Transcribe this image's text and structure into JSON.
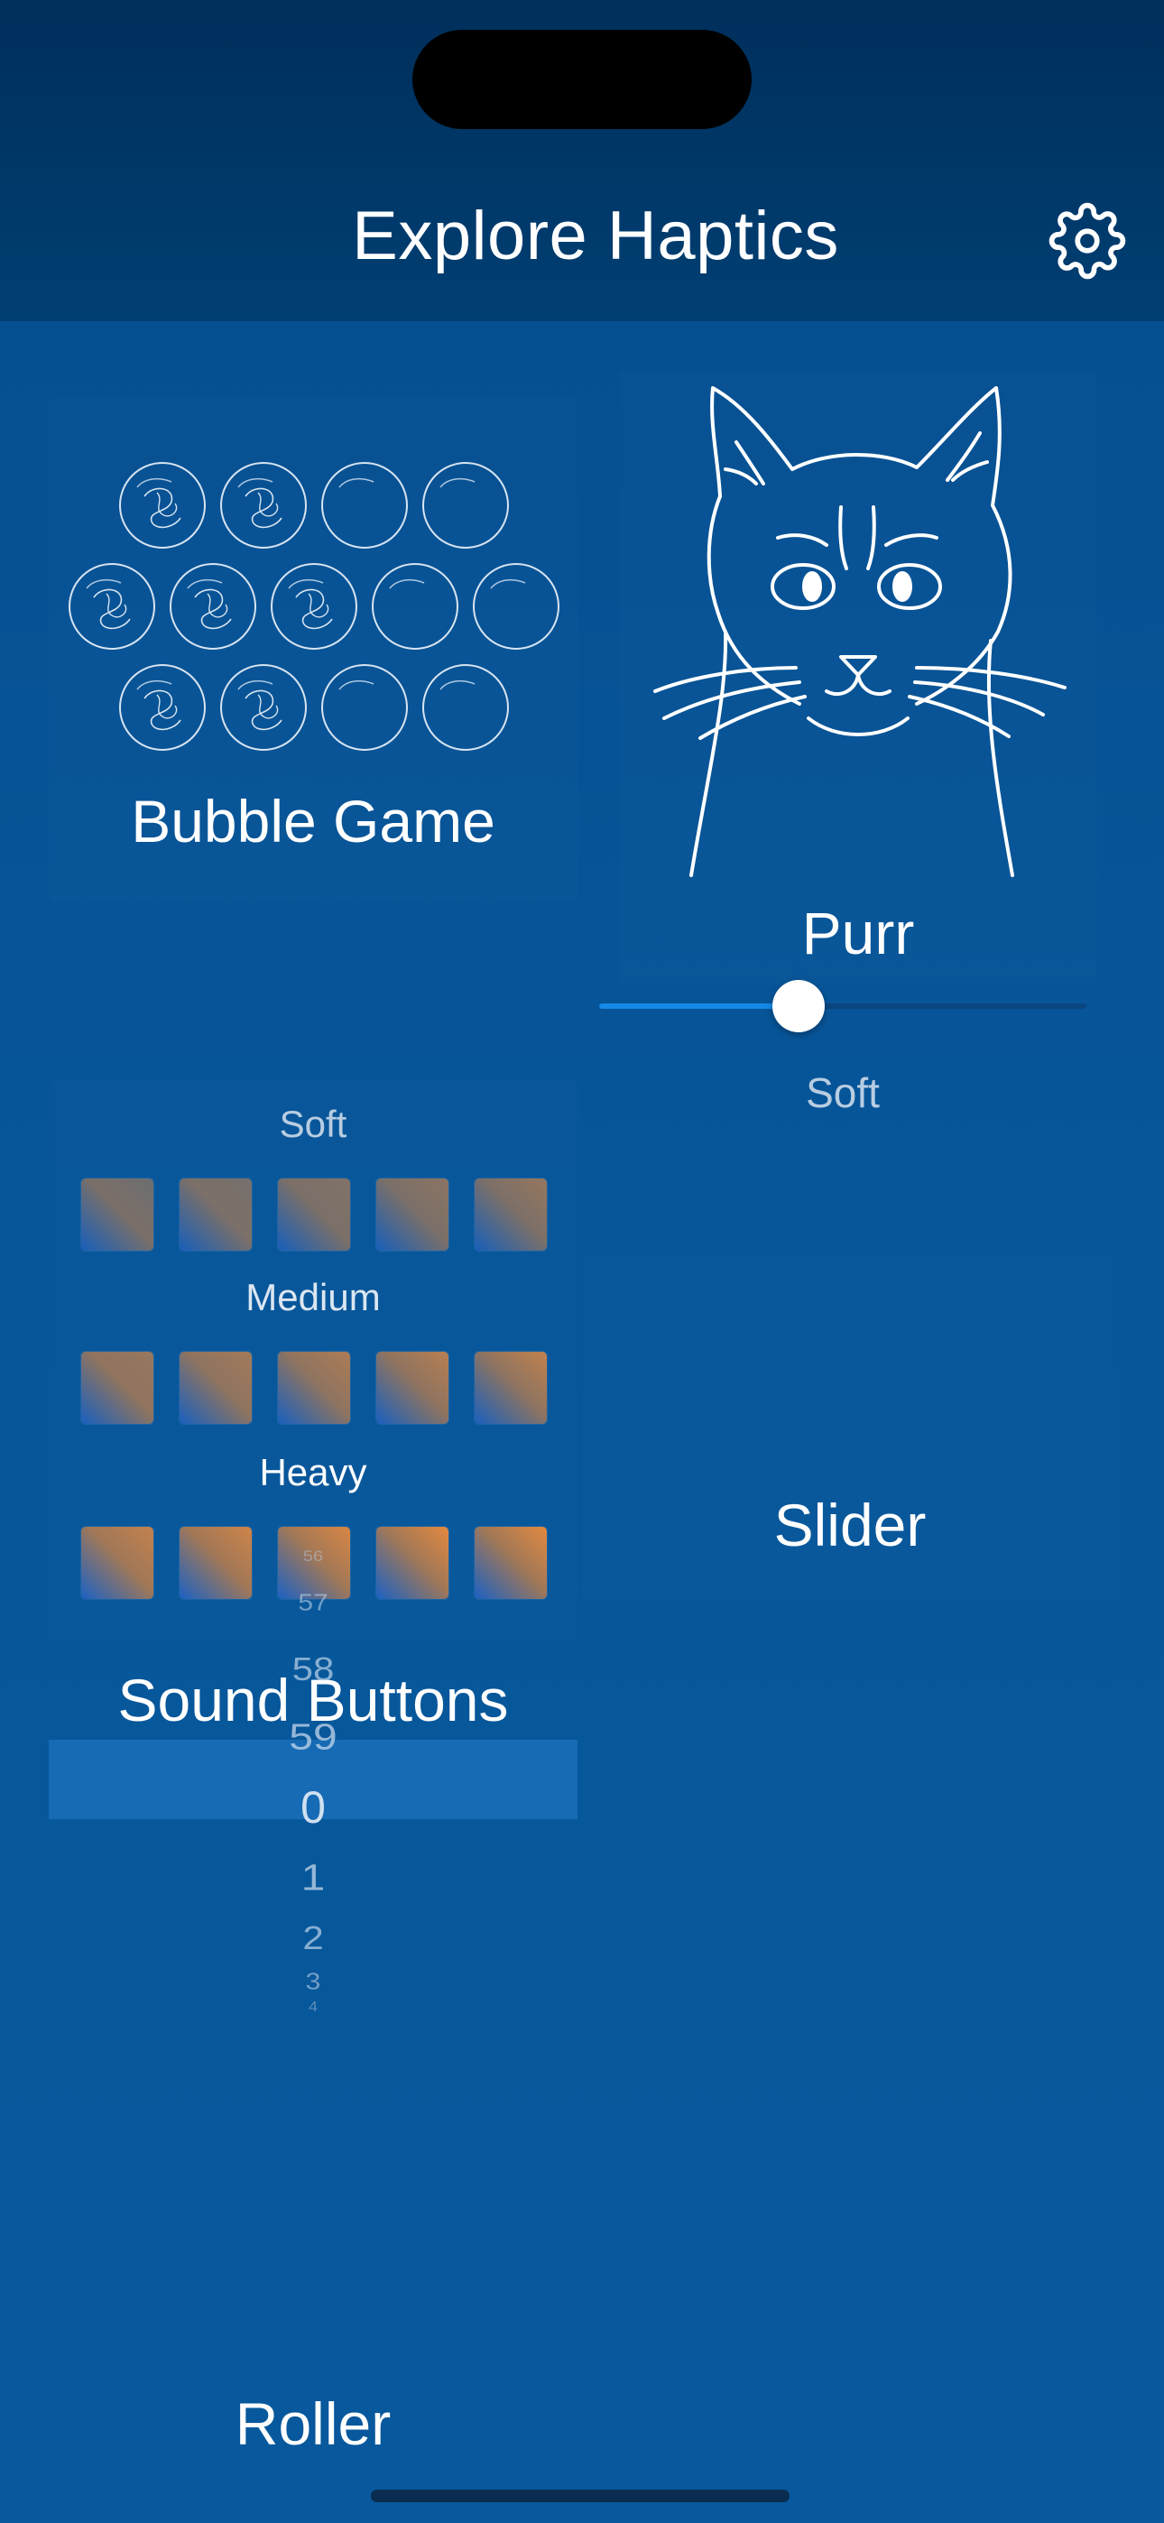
{
  "nav": {
    "title": "Explore Haptics",
    "settings_icon": "gear-icon"
  },
  "tiles": {
    "bubble_game": {
      "label": "Bubble Game"
    },
    "purr": {
      "label": "Purr"
    },
    "sound_buttons": {
      "label": "Sound Buttons",
      "rows": [
        {
          "intensity": "Soft"
        },
        {
          "intensity": "Medium"
        },
        {
          "intensity": "Heavy"
        }
      ]
    },
    "slider": {
      "label": "Slider",
      "value_text": "Soft",
      "value": 0.41
    },
    "roller": {
      "label": "Roller",
      "items": [
        "56",
        "57",
        "58",
        "59",
        "0",
        "1",
        "2",
        "3",
        "4"
      ],
      "selected": "0"
    }
  },
  "colors": {
    "background": "#07569a",
    "nav_background": "#003a6c",
    "accent": "#1589e6",
    "button_orange": "#e3893f",
    "button_blue": "#1d62c8"
  }
}
